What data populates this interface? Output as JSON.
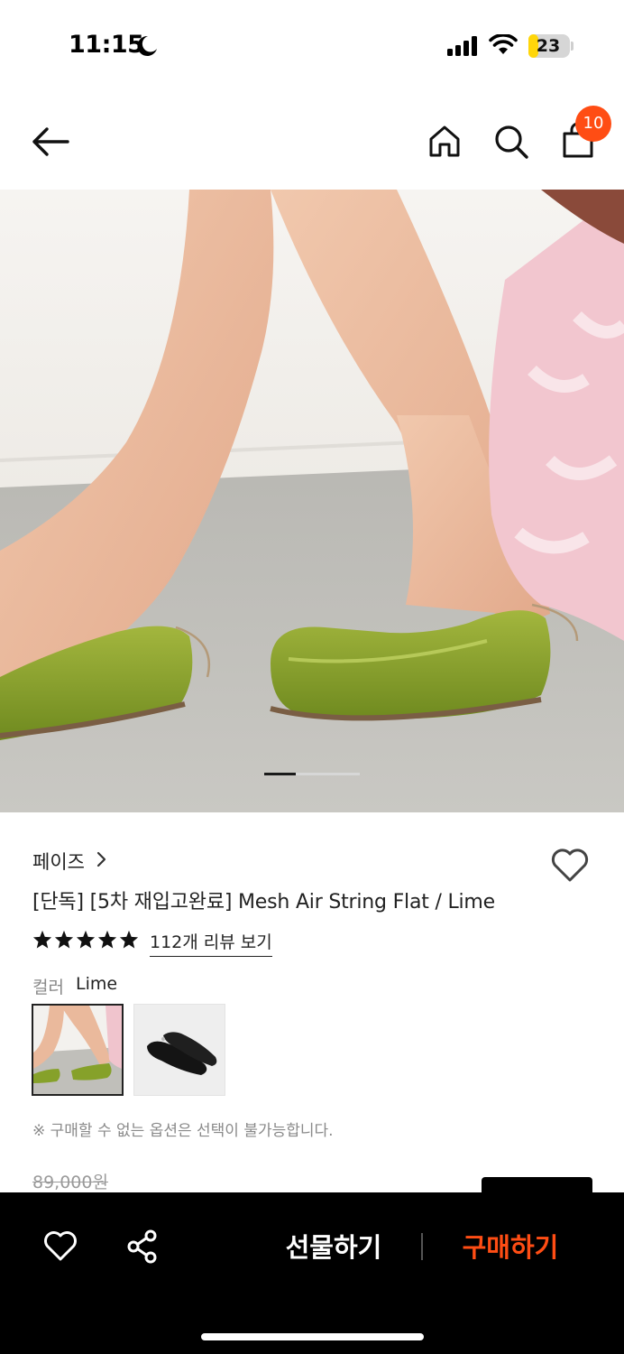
{
  "status_bar": {
    "time": "11:15",
    "battery": "23",
    "battery_level": 0.23,
    "icons": [
      "moon-icon",
      "cellular-signal-icon",
      "wifi-icon",
      "battery-icon"
    ]
  },
  "nav": {
    "icons": [
      "back-arrow-icon",
      "home-icon",
      "search-icon",
      "shopping-bag-icon"
    ],
    "cart_count": "10"
  },
  "hero": {
    "slide_count": 2,
    "active_slide": 1
  },
  "product": {
    "brand": "페이즈",
    "title": "[단독] [5차 재입고완료] Mesh Air String Flat / Lime",
    "rating_stars": 5,
    "review_link": "112개 리뷰 보기",
    "color_label": "컬러",
    "color_value": "Lime",
    "swatches": [
      "Lime",
      "Black"
    ],
    "selected_swatch": "Lime",
    "notice": "※ 구매할 수 없는 옵션은 선택이 불가능합니다.",
    "original_price": "89,000원"
  },
  "bottom_bar": {
    "gift_label": "선물하기",
    "buy_label": "구매하기"
  },
  "colors": {
    "accent": "#ff4d14",
    "badge": "#ff4d14",
    "battery": "#ffd60a",
    "bottom_bar": "#000000"
  }
}
